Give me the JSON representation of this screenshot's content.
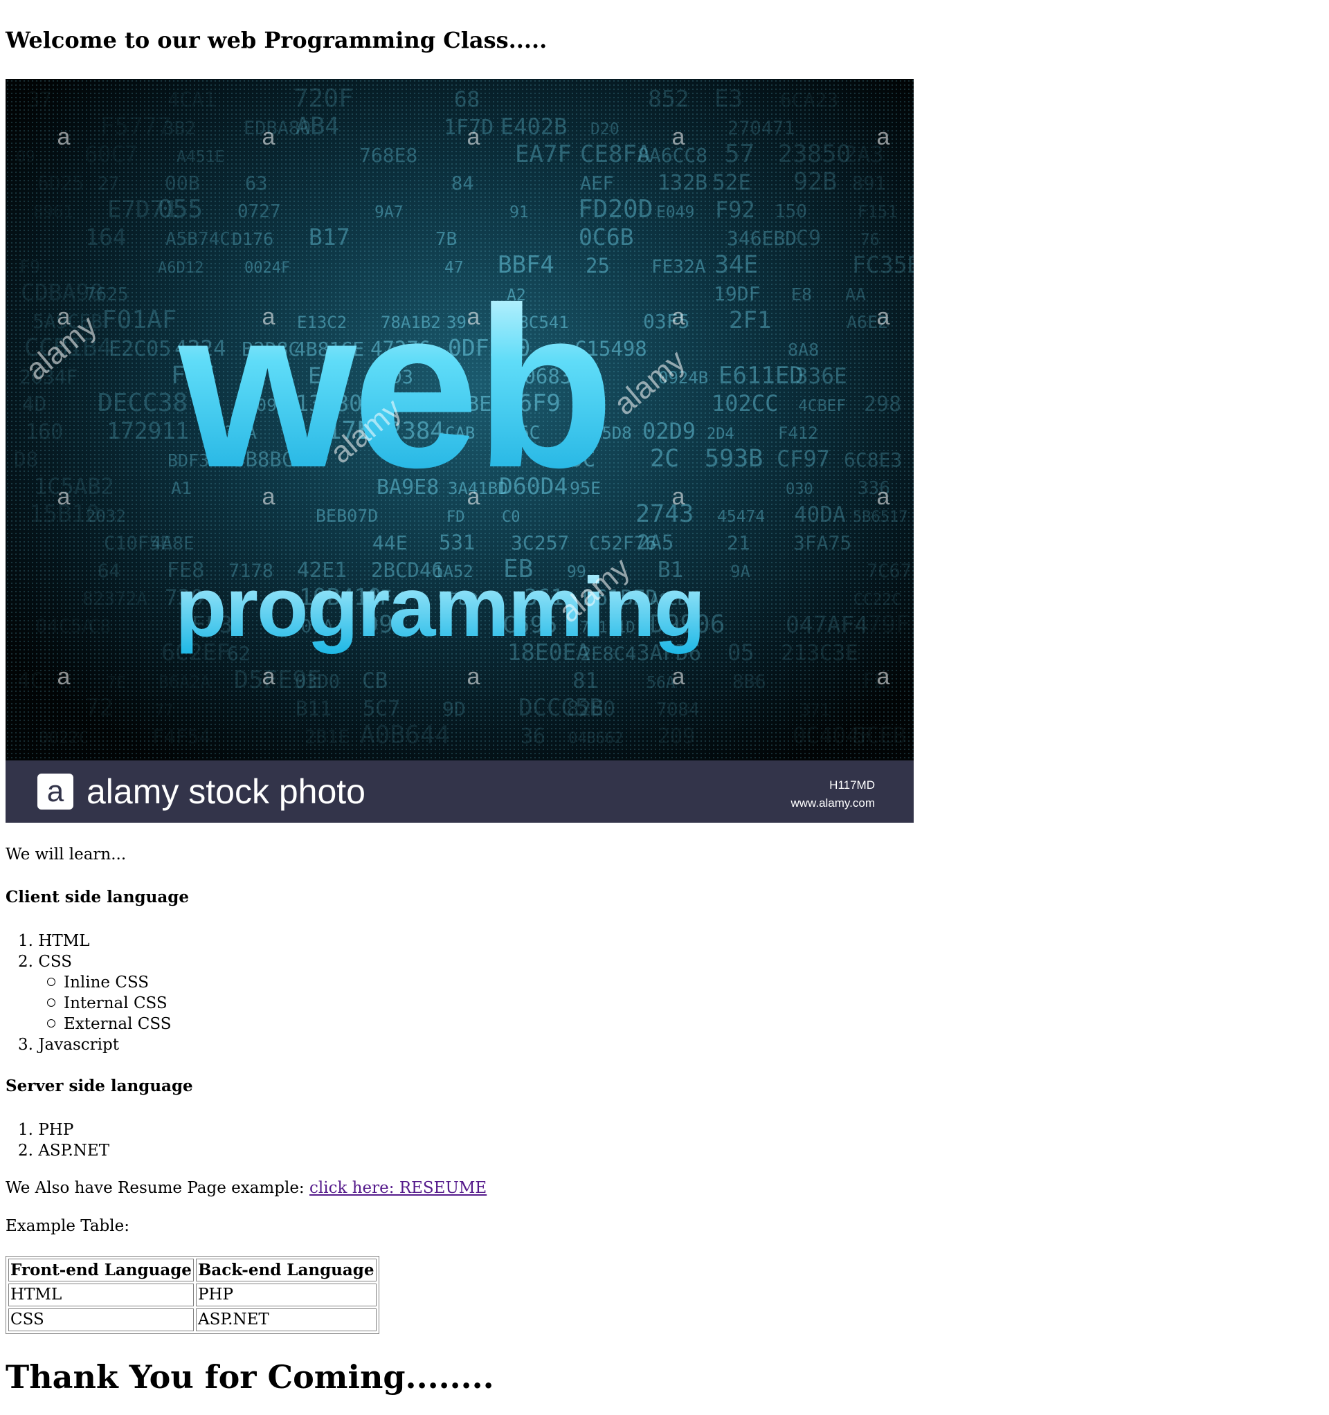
{
  "page": {
    "title": "Welcome to our web Programming Class.....",
    "banner": {
      "headline": "web",
      "subline": "programming",
      "brand": "alamy stock photo",
      "brand_logo_letter": "a",
      "watermark": "alamy",
      "image_id": "H117MD",
      "website": "www.alamy.com",
      "footer_color": "#33344a",
      "glow_color": "#21c8f0"
    },
    "intro": "We will learn...",
    "client_heading": "Client side language",
    "client_list": [
      "HTML",
      "CSS",
      "Javascript"
    ],
    "client_markers": [
      "1.",
      "2.",
      "3."
    ],
    "css_sublist": [
      "Inline CSS",
      "Internal CSS",
      "External CSS"
    ],
    "server_heading": "Server side language",
    "server_list": [
      "PHP",
      "ASP.NET"
    ],
    "server_markers": [
      "1.",
      "2."
    ],
    "resume_text": "We Also have Resume Page example: ",
    "resume_link": "click here: RESEUME",
    "table_label": "Example Table:",
    "table": {
      "headers": [
        "Front-end Language",
        "Back-end Language"
      ],
      "rows": [
        [
          "HTML",
          "PHP"
        ],
        [
          "CSS",
          "ASP.NET"
        ]
      ]
    },
    "closing": "Thank You for Coming........"
  }
}
